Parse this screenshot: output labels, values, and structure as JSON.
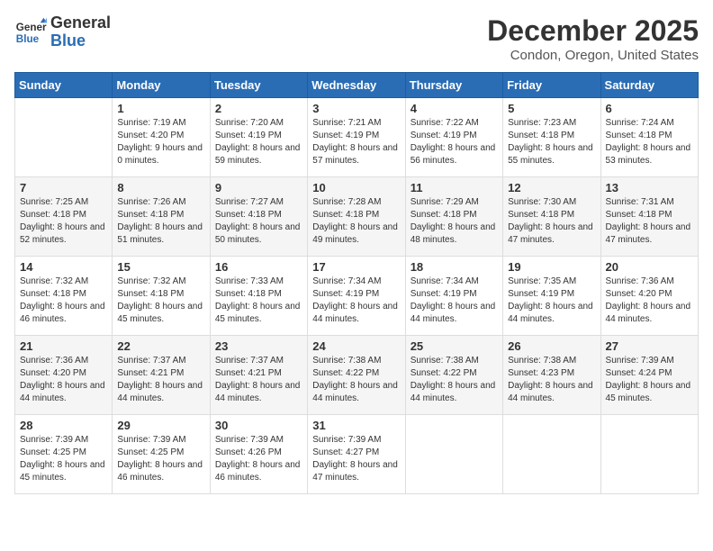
{
  "header": {
    "logo_general": "General",
    "logo_blue": "Blue",
    "month_title": "December 2025",
    "location": "Condon, Oregon, United States"
  },
  "weekdays": [
    "Sunday",
    "Monday",
    "Tuesday",
    "Wednesday",
    "Thursday",
    "Friday",
    "Saturday"
  ],
  "weeks": [
    [
      {
        "day": "",
        "sunrise": "",
        "sunset": "",
        "daylight": ""
      },
      {
        "day": "1",
        "sunrise": "Sunrise: 7:19 AM",
        "sunset": "Sunset: 4:20 PM",
        "daylight": "Daylight: 9 hours and 0 minutes."
      },
      {
        "day": "2",
        "sunrise": "Sunrise: 7:20 AM",
        "sunset": "Sunset: 4:19 PM",
        "daylight": "Daylight: 8 hours and 59 minutes."
      },
      {
        "day": "3",
        "sunrise": "Sunrise: 7:21 AM",
        "sunset": "Sunset: 4:19 PM",
        "daylight": "Daylight: 8 hours and 57 minutes."
      },
      {
        "day": "4",
        "sunrise": "Sunrise: 7:22 AM",
        "sunset": "Sunset: 4:19 PM",
        "daylight": "Daylight: 8 hours and 56 minutes."
      },
      {
        "day": "5",
        "sunrise": "Sunrise: 7:23 AM",
        "sunset": "Sunset: 4:18 PM",
        "daylight": "Daylight: 8 hours and 55 minutes."
      },
      {
        "day": "6",
        "sunrise": "Sunrise: 7:24 AM",
        "sunset": "Sunset: 4:18 PM",
        "daylight": "Daylight: 8 hours and 53 minutes."
      }
    ],
    [
      {
        "day": "7",
        "sunrise": "Sunrise: 7:25 AM",
        "sunset": "Sunset: 4:18 PM",
        "daylight": "Daylight: 8 hours and 52 minutes."
      },
      {
        "day": "8",
        "sunrise": "Sunrise: 7:26 AM",
        "sunset": "Sunset: 4:18 PM",
        "daylight": "Daylight: 8 hours and 51 minutes."
      },
      {
        "day": "9",
        "sunrise": "Sunrise: 7:27 AM",
        "sunset": "Sunset: 4:18 PM",
        "daylight": "Daylight: 8 hours and 50 minutes."
      },
      {
        "day": "10",
        "sunrise": "Sunrise: 7:28 AM",
        "sunset": "Sunset: 4:18 PM",
        "daylight": "Daylight: 8 hours and 49 minutes."
      },
      {
        "day": "11",
        "sunrise": "Sunrise: 7:29 AM",
        "sunset": "Sunset: 4:18 PM",
        "daylight": "Daylight: 8 hours and 48 minutes."
      },
      {
        "day": "12",
        "sunrise": "Sunrise: 7:30 AM",
        "sunset": "Sunset: 4:18 PM",
        "daylight": "Daylight: 8 hours and 47 minutes."
      },
      {
        "day": "13",
        "sunrise": "Sunrise: 7:31 AM",
        "sunset": "Sunset: 4:18 PM",
        "daylight": "Daylight: 8 hours and 47 minutes."
      }
    ],
    [
      {
        "day": "14",
        "sunrise": "Sunrise: 7:32 AM",
        "sunset": "Sunset: 4:18 PM",
        "daylight": "Daylight: 8 hours and 46 minutes."
      },
      {
        "day": "15",
        "sunrise": "Sunrise: 7:32 AM",
        "sunset": "Sunset: 4:18 PM",
        "daylight": "Daylight: 8 hours and 45 minutes."
      },
      {
        "day": "16",
        "sunrise": "Sunrise: 7:33 AM",
        "sunset": "Sunset: 4:18 PM",
        "daylight": "Daylight: 8 hours and 45 minutes."
      },
      {
        "day": "17",
        "sunrise": "Sunrise: 7:34 AM",
        "sunset": "Sunset: 4:19 PM",
        "daylight": "Daylight: 8 hours and 44 minutes."
      },
      {
        "day": "18",
        "sunrise": "Sunrise: 7:34 AM",
        "sunset": "Sunset: 4:19 PM",
        "daylight": "Daylight: 8 hours and 44 minutes."
      },
      {
        "day": "19",
        "sunrise": "Sunrise: 7:35 AM",
        "sunset": "Sunset: 4:19 PM",
        "daylight": "Daylight: 8 hours and 44 minutes."
      },
      {
        "day": "20",
        "sunrise": "Sunrise: 7:36 AM",
        "sunset": "Sunset: 4:20 PM",
        "daylight": "Daylight: 8 hours and 44 minutes."
      }
    ],
    [
      {
        "day": "21",
        "sunrise": "Sunrise: 7:36 AM",
        "sunset": "Sunset: 4:20 PM",
        "daylight": "Daylight: 8 hours and 44 minutes."
      },
      {
        "day": "22",
        "sunrise": "Sunrise: 7:37 AM",
        "sunset": "Sunset: 4:21 PM",
        "daylight": "Daylight: 8 hours and 44 minutes."
      },
      {
        "day": "23",
        "sunrise": "Sunrise: 7:37 AM",
        "sunset": "Sunset: 4:21 PM",
        "daylight": "Daylight: 8 hours and 44 minutes."
      },
      {
        "day": "24",
        "sunrise": "Sunrise: 7:38 AM",
        "sunset": "Sunset: 4:22 PM",
        "daylight": "Daylight: 8 hours and 44 minutes."
      },
      {
        "day": "25",
        "sunrise": "Sunrise: 7:38 AM",
        "sunset": "Sunset: 4:22 PM",
        "daylight": "Daylight: 8 hours and 44 minutes."
      },
      {
        "day": "26",
        "sunrise": "Sunrise: 7:38 AM",
        "sunset": "Sunset: 4:23 PM",
        "daylight": "Daylight: 8 hours and 44 minutes."
      },
      {
        "day": "27",
        "sunrise": "Sunrise: 7:39 AM",
        "sunset": "Sunset: 4:24 PM",
        "daylight": "Daylight: 8 hours and 45 minutes."
      }
    ],
    [
      {
        "day": "28",
        "sunrise": "Sunrise: 7:39 AM",
        "sunset": "Sunset: 4:25 PM",
        "daylight": "Daylight: 8 hours and 45 minutes."
      },
      {
        "day": "29",
        "sunrise": "Sunrise: 7:39 AM",
        "sunset": "Sunset: 4:25 PM",
        "daylight": "Daylight: 8 hours and 46 minutes."
      },
      {
        "day": "30",
        "sunrise": "Sunrise: 7:39 AM",
        "sunset": "Sunset: 4:26 PM",
        "daylight": "Daylight: 8 hours and 46 minutes."
      },
      {
        "day": "31",
        "sunrise": "Sunrise: 7:39 AM",
        "sunset": "Sunset: 4:27 PM",
        "daylight": "Daylight: 8 hours and 47 minutes."
      },
      {
        "day": "",
        "sunrise": "",
        "sunset": "",
        "daylight": ""
      },
      {
        "day": "",
        "sunrise": "",
        "sunset": "",
        "daylight": ""
      },
      {
        "day": "",
        "sunrise": "",
        "sunset": "",
        "daylight": ""
      }
    ]
  ]
}
